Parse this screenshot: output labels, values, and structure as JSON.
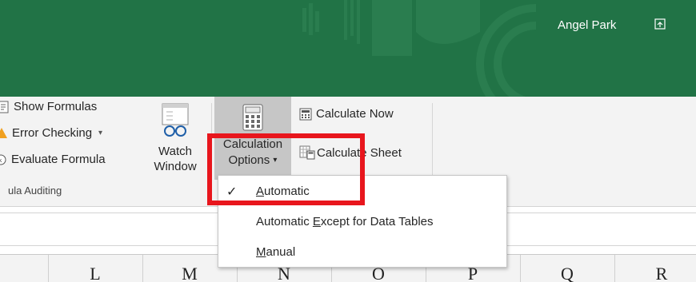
{
  "title_bar": {
    "user_name": "Angel Park",
    "ribbon_display_icon": "ribbon-display-options-icon",
    "background": "#217346"
  },
  "ribbon": {
    "show_formulas": "Show Formulas",
    "error_checking": "Error Checking",
    "evaluate_formula": "Evaluate Formula",
    "group_label": "ula Auditing",
    "watch_window": {
      "line1": "Watch",
      "line2": "Window"
    },
    "calculation_options": {
      "line1": "Calculation",
      "line2": "Options"
    },
    "calculate_now": "Calculate Now",
    "calculate_sheet": "Calculate Sheet"
  },
  "menu": {
    "items": [
      {
        "pre": "",
        "key": "A",
        "post": "utomatic",
        "checked": true
      },
      {
        "pre": "Automatic ",
        "key": "E",
        "post": "xcept for Data Tables",
        "checked": false
      },
      {
        "pre": "",
        "key": "M",
        "post": "anual",
        "checked": false
      }
    ]
  },
  "columns": [
    "L",
    "M",
    "N",
    "O",
    "P",
    "Q",
    "R"
  ],
  "colors": {
    "accent": "#217346",
    "highlight": "#e8161d",
    "pressed": "#c6c6c6"
  }
}
